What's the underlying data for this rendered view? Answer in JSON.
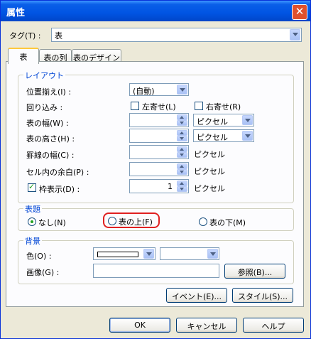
{
  "window": {
    "title": "属性"
  },
  "tag": {
    "label": "タグ(T) :",
    "value": "表"
  },
  "tabs": [
    {
      "label": "表"
    },
    {
      "label": "表の列"
    },
    {
      "label": "表のデザイン"
    }
  ],
  "layout": {
    "group_title": "レイアウト",
    "align": {
      "label": "位置揃え(I) :",
      "value": "(自動)"
    },
    "wrap": {
      "label": "回り込み :",
      "left": "左寄せ(L)",
      "right": "右寄せ(R)"
    },
    "width": {
      "label": "表の幅(W) :",
      "unit": "ピクセル"
    },
    "height": {
      "label": "表の高さ(H) :",
      "unit": "ピクセル"
    },
    "border_width": {
      "label": "罫線の幅(C) :",
      "unit": "ピクセル"
    },
    "padding": {
      "label": "セル内の余白(P) :",
      "unit": "ピクセル"
    },
    "frame": {
      "label": "枠表示(D) :",
      "value": "1",
      "unit": "ピクセル",
      "checked": true
    }
  },
  "caption": {
    "group_title": "表題",
    "none": "なし(N)",
    "above": "表の上(F)",
    "below": "表の下(M)",
    "selected": "none"
  },
  "background": {
    "group_title": "背景",
    "color_label": "色(O) :",
    "image_label": "画像(G) :",
    "browse": "参照(B)..."
  },
  "panel_buttons": {
    "event": "イベント(E)...",
    "style": "スタイル(S)..."
  },
  "dialog_buttons": {
    "ok": "OK",
    "cancel": "キャンセル",
    "help": "ヘルプ"
  },
  "colors": {
    "titlebar": "#0054e3",
    "accent": "#0046d5",
    "highlight": "#e02020"
  }
}
